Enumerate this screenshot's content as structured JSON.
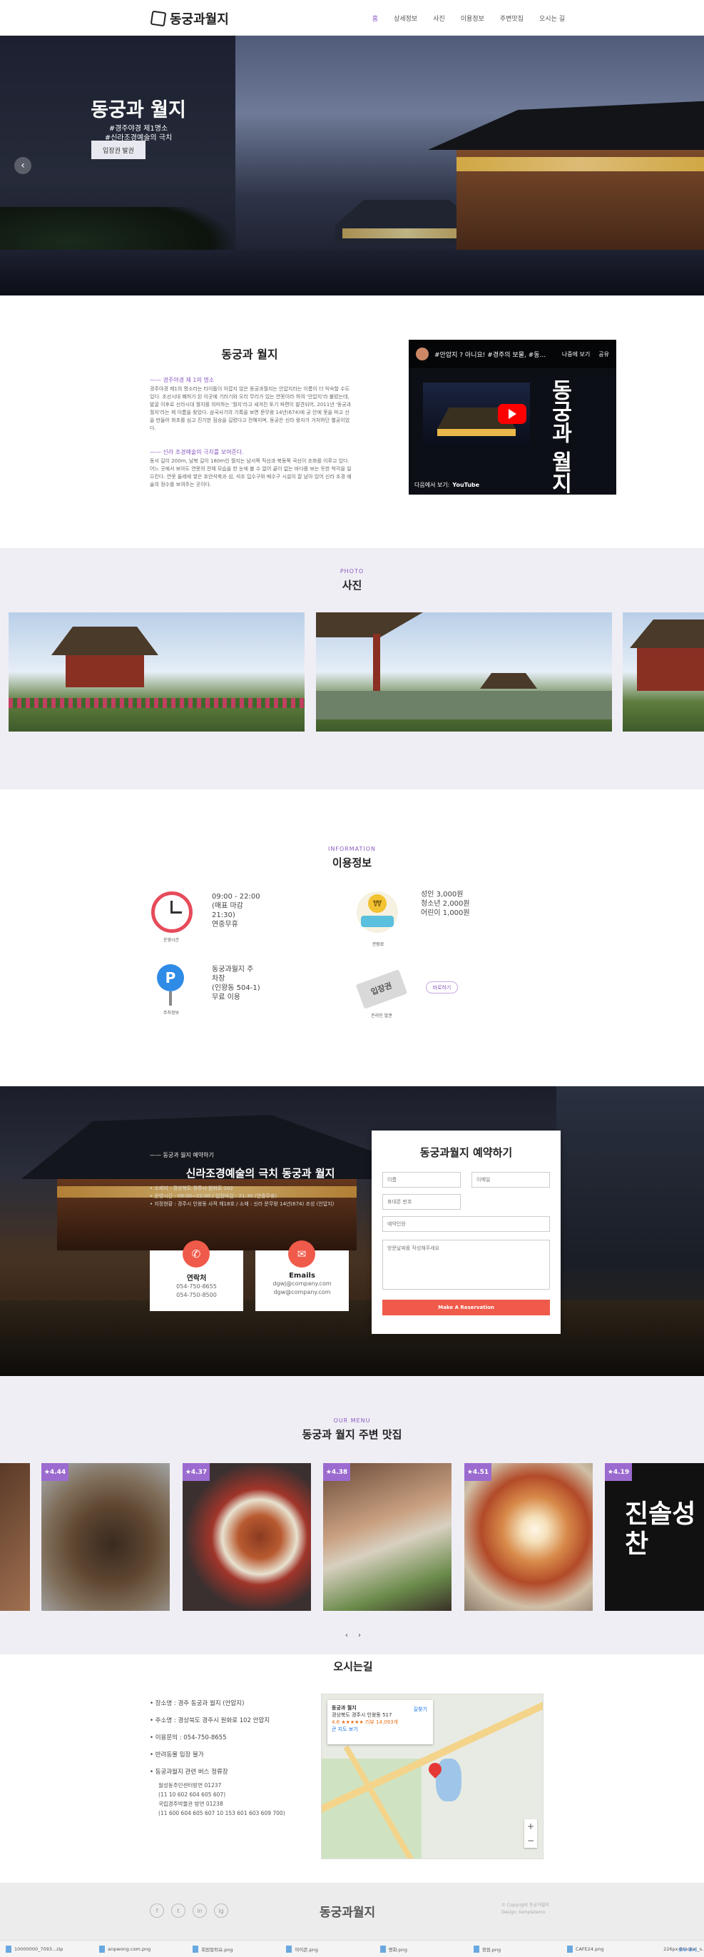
{
  "header": {
    "logo": "동궁과월지",
    "nav": [
      "홈",
      "상세정보",
      "사진",
      "이용정보",
      "주변맛집",
      "오시는 길"
    ]
  },
  "hero": {
    "title": "동궁과 월지",
    "tag1": "#경주야경 제1명소",
    "tag2": "#신라조경예술의 극치",
    "button": "입장권 발권"
  },
  "intro": {
    "title": "동궁과 월지",
    "lead1": "—— 경주야경 제 1의 명소",
    "text1": "경주야경 제1의 명소라는 타이틀이 아깝지 않은 동궁과월지는 안압지라는 이름이 더 익숙할 수도 있다. 조선시대 폐허가 된 이곳에 기러기와 오리 무리가 있는 연못이라 하여 '안압지'라 불렀는데, 발굴 이후로 신라시대 월지를 의미하는 '월지'라고 새겨진 토기 파편이 발견되어, 2011년 '동궁과 월지'라는 제 이름을 찾았다. 삼국사기의 기록을 보면 문무왕 14년(674)에 궁 안에 못을 파고 산을 만들어 화초를 심고 진기한 짐승을 길렀다고 전해지며, 동궁은 신라 왕자가 거처하던 별궁이었다.",
    "lead2": "—— 신라 조경예술의 극치를 보여준다.",
    "text2": "동서 길이 200m, 남북 길이 180m인 월지는 남서쪽 직선과 북동쪽 곡선이 조화를 이루고 있다. 어느 곳에서 보아도 연못의 전체 모습을 한 눈에 볼 수 없어 끝이 없는 바다를 보는 듯한 착각을 일으킨다. 연못 둘레에 쌓은 호안석축과 섬, 석조 입수구와 배수구 시설이 잘 남아 있어 신라 조경 예술의 정수를 보여주는 곳이다."
  },
  "video": {
    "caption": "#안압지 ? 아니요! #경주의 보물, #동...",
    "later": "나중에 보기",
    "share": "공유",
    "overlay": "동궁과 월지",
    "watch": "다음에서 보기:",
    "youtube": "YouTube"
  },
  "photo": {
    "kicker": "PHOTO",
    "title": "사진"
  },
  "info": {
    "kicker": "INFORMATION",
    "title": "이용정보",
    "hours": {
      "label": "운영시간",
      "lines": [
        "09:00 - 22:00",
        "(매표 마감",
        "21:30)",
        "연중무휴"
      ]
    },
    "fee": {
      "label": "관람료",
      "lines": [
        "성인 3,000원",
        "청소년 2,000원",
        "어린이 1,000원"
      ]
    },
    "parking": {
      "label": "주차정보",
      "lines": [
        "동궁과월지 주",
        "차장",
        "(인왕동 504-1)",
        "무료 이용"
      ]
    },
    "ticket": {
      "label": "온라인 발권",
      "button": "바로하기",
      "badge": "입장권"
    }
  },
  "reservation": {
    "kicker": "—— 동궁과 월지 예약하기",
    "title": "신라조경예술의 극치 동궁과 월지",
    "lines": [
      "• 소재지 : 경상북도 경주시 원화로 102",
      "• 운영시간 : 09:00~22:00 / 입장마감 : 21:30 (연중무휴)",
      "• 지정현황 : 경주시 인왕동 사적 제18호 / 소재 : 신라 문무왕 14년(674) 조성 (안압지)"
    ],
    "phone": {
      "title": "연락처",
      "lines": [
        "054-750-8655",
        "054-750-8500"
      ]
    },
    "email": {
      "title": "Emails",
      "lines": [
        "dgwj@company.com",
        "dgw@company.com"
      ]
    },
    "form": {
      "title": "동궁과월지 예약하기",
      "name": "이름",
      "email": "이메일",
      "phone": "휴대폰 번호",
      "date": "예약인원",
      "message": "방문날짜를 작성해주세요",
      "submit": "Make A Reservation"
    }
  },
  "menu": {
    "kicker": "OUR MENU",
    "title": "동궁과 월지 주변 맛집",
    "ratings": [
      "★4.44",
      "★4.37",
      "★4.38",
      "★4.51",
      "★4.19"
    ],
    "sign": "진솔성찬"
  },
  "location": {
    "title": "오시는길",
    "items": [
      "• 장소명 : 경주 동궁과 월지 (안압지)",
      "• 주소명 : 경상북도 경주시 원화로 102 안압지",
      "• 이용문의 : 054-750-8655",
      "• 반려동물 입장 불가",
      "• 동궁과월지 관련 버스 정류장"
    ],
    "bus": [
      "월성동주민센터방면 01237",
      "(11 10 602 604 605 607)",
      "국립경주박물관 방면 01238",
      "(11 600 604 605 607 10 153 601 603 609 700)"
    ],
    "map": {
      "name": "동궁과 월지",
      "addr": "경상북도 경주시 인왕동 517",
      "rating": "4.6 ★★★★★ 리뷰 14,093개",
      "more": "큰 지도 보기",
      "dir": "길찾기"
    }
  },
  "footer": {
    "logo": "동궁과월지",
    "copy1": "© Copyright 동궁과월지",
    "copy2": "Design: templatemo",
    "social": [
      "f",
      "t",
      "in",
      "ig"
    ]
  },
  "downloads": [
    "10000000_7093...zip",
    "anpwong.com.png",
    "회원탈퇴요.png",
    "아이콘.png",
    "평화.png",
    "정원.png",
    "CAFE24.png",
    "226px-Bracket_s...png"
  ],
  "download_all": "모두 표시"
}
